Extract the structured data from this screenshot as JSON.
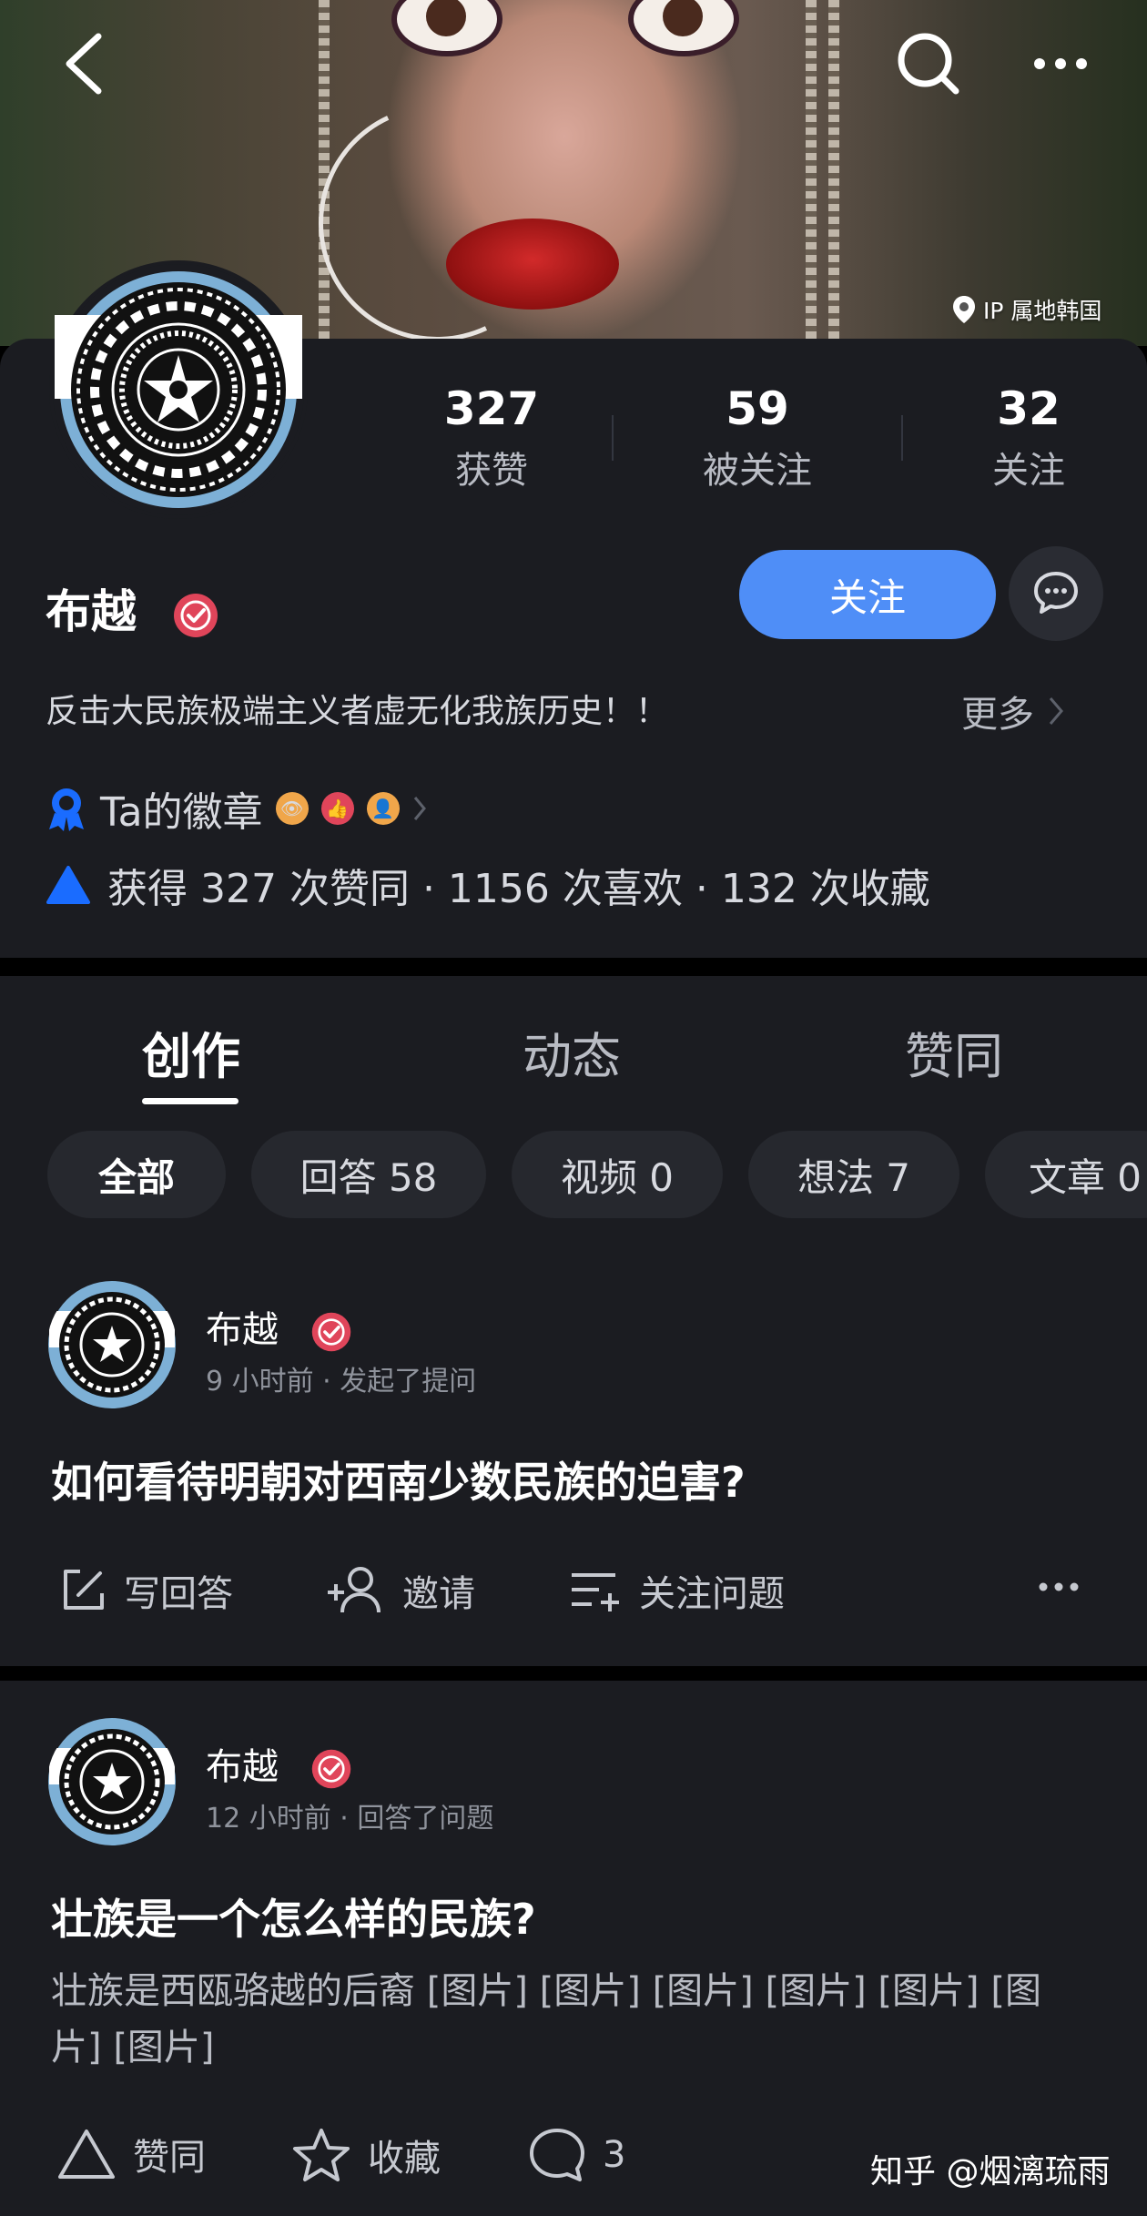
{
  "cover": {
    "ip_location": "IP 属地韩国"
  },
  "profile": {
    "name": "布越",
    "bio": "反击大民族极端主义者虚无化我族历史！！",
    "more_label": "更多",
    "follow_label": "关注",
    "stats": [
      {
        "value": "327",
        "label": "获赞"
      },
      {
        "value": "59",
        "label": "被关注"
      },
      {
        "value": "32",
        "label": "关注"
      }
    ],
    "badges_label": "Ta的徽章",
    "summary": "获得 327 次赞同 · 1156 次喜欢 · 132 次收藏"
  },
  "tabs": [
    "创作",
    "动态",
    "赞同"
  ],
  "active_tab": "创作",
  "filter_chips": [
    "全部",
    "回答 58",
    "视频 0",
    "想法 7",
    "文章 0"
  ],
  "feed": [
    {
      "author": "布越",
      "meta": "9 小时前 · 发起了提问",
      "title": "如何看待明朝对西南少数民族的迫害?",
      "actions": [
        "写回答",
        "邀请",
        "关注问题"
      ]
    },
    {
      "author": "布越",
      "meta": "12 小时前 · 回答了问题",
      "title": "壮族是一个怎么样的民族?",
      "excerpt": "壮族是西瓯骆越的后裔 [图片] [图片] [图片] [图片] [图片] [图片] [图片]",
      "actions": [
        "赞同",
        "收藏",
        "3"
      ]
    }
  ],
  "watermark": "知乎 @烟漓琉雨",
  "colors": {
    "accent": "#4f8ef7",
    "card_bg": "#1b1c21",
    "chip_bg": "#26282e",
    "verified": "#e0455a"
  }
}
